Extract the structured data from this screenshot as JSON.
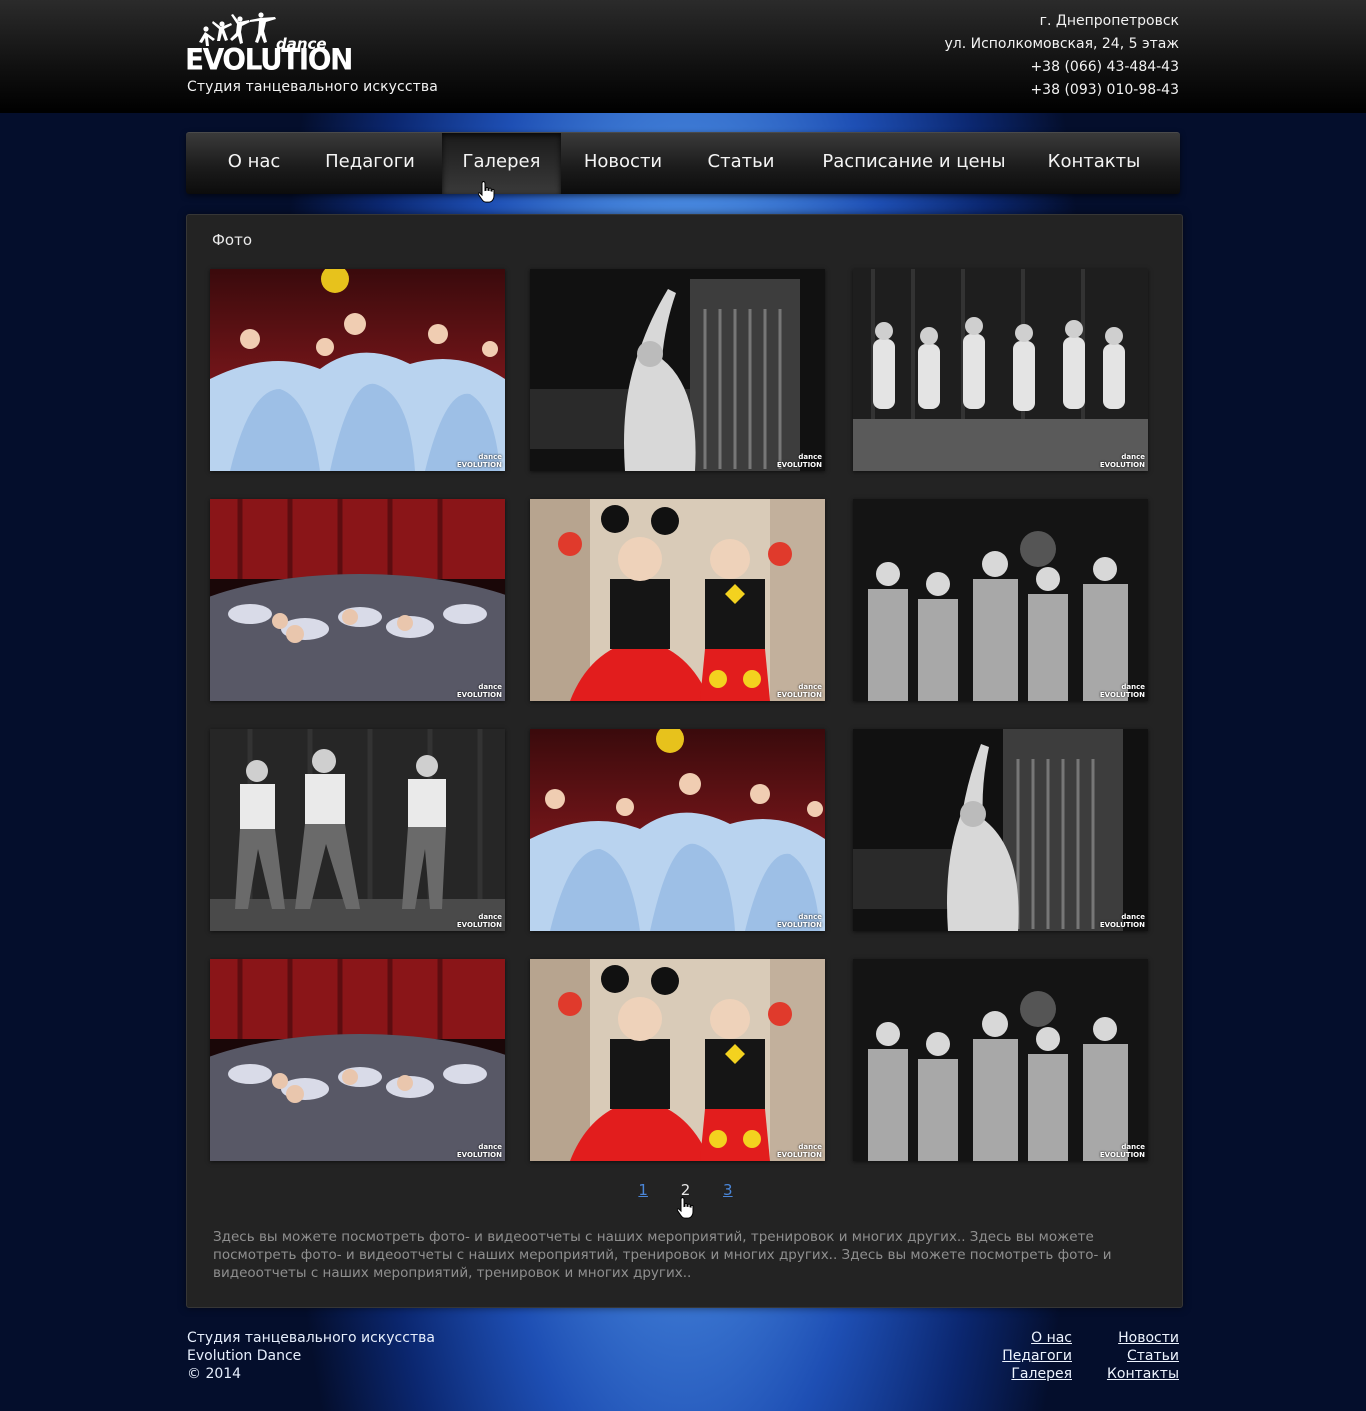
{
  "header": {
    "logo_text_top": "dance",
    "logo_text_main": "EVOLUTION",
    "tagline": "Студия танцевального искусства",
    "contacts": [
      "г. Днепропетровск",
      "ул. Исполкомовская, 24, 5 этаж",
      "+38 (066) 43-484-43",
      "+38 (093) 010-98-43"
    ]
  },
  "nav": {
    "items": [
      "О нас",
      "Педагоги",
      "Галерея",
      "Новости",
      "Статьи",
      "Расписание и цены",
      "Контакты"
    ],
    "active": "Галерея"
  },
  "content": {
    "section_title": "Фото",
    "photo_watermark": "dance EVOLUTION",
    "photos": [
      "girls-blue-dresses-color",
      "woman-arm-raised-bw",
      "kids-dancing-bw",
      "kids-lying-stage-color",
      "kids-mickey-costume-color",
      "women-group-bw",
      "women-jeans-bw",
      "girls-blue-dresses-color",
      "woman-arm-raised-bw",
      "kids-lying-stage-color",
      "kids-mickey-costume-color",
      "women-group-bw"
    ],
    "pagination": {
      "pages": [
        "1",
        "2",
        "3"
      ],
      "current": "2"
    },
    "description": "Здесь вы можете посмотреть фото- и видеоотчеты с наших мероприятий, тренировок и многих других.. Здесь вы можете посмотреть фото- и видеоотчеты с наших мероприятий, тренировок и многих других.. Здесь вы можете посмотреть фото- и видеоотчеты с наших мероприятий, тренировок и многих других.."
  },
  "footer": {
    "line1": "Студия танцевального искусства",
    "line2": "Evolution Dance",
    "line3": "© 2014",
    "links_col1": [
      "О нас",
      "Педагоги",
      "Галерея"
    ],
    "links_col2": [
      "Новости",
      "Статьи",
      "Контакты"
    ]
  },
  "colors": {
    "accent_blue": "#4a86d8",
    "panel_bg": "#232323",
    "header_bg": "#101010"
  },
  "icons": {
    "cursor": "hand-pointer-icon"
  }
}
